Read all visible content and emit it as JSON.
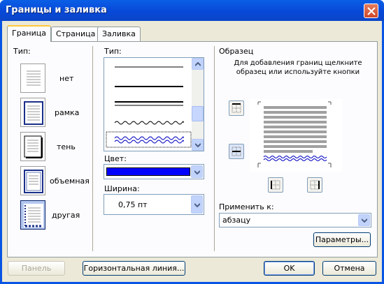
{
  "window": {
    "title": "Границы и заливка"
  },
  "tabs": [
    {
      "label": "Граница",
      "active": true
    },
    {
      "label": "Страница",
      "active": false
    },
    {
      "label": "Заливка",
      "active": false
    }
  ],
  "type_section": {
    "heading": "Тип:",
    "settings": [
      {
        "label": "нет",
        "selected": false
      },
      {
        "label": "рамка",
        "selected": false
      },
      {
        "label": "тень",
        "selected": false
      },
      {
        "label": "объемная",
        "selected": false
      },
      {
        "label": "другая",
        "selected": true
      }
    ]
  },
  "style_section": {
    "heading": "Тип:",
    "line_styles": [
      "single-thin",
      "single-medium",
      "double",
      "wavy",
      "double-wavy"
    ],
    "selected_style": "double-wavy",
    "color_label": "Цвет:",
    "color_value": "#0000ff",
    "width_label": "Ширина:",
    "width_value": "0,75 пт"
  },
  "preview_section": {
    "heading": "Образец",
    "hint": "Для добавления границ щелкните образец или используйте кнопки",
    "apply_label": "Применить к:",
    "apply_value": "абзацу",
    "params_button": "Параметры..."
  },
  "footer": {
    "panel_button": "Панель",
    "hline_button": "Горизонтальная линия...",
    "ok_button": "OK",
    "cancel_button": "Отмена"
  },
  "colors": {
    "title_bar": "#0854e3",
    "dialog_bg": "#ece9d8",
    "accent_tab": "#ffc83c",
    "border_color": "#0000ff"
  }
}
